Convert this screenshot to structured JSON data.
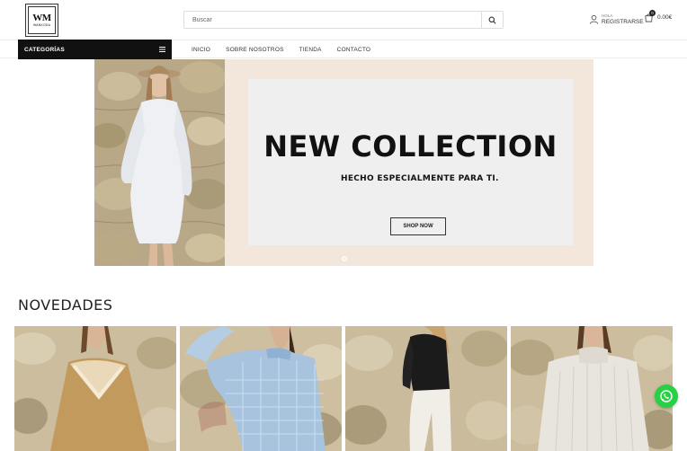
{
  "header": {
    "logo_text": "WM",
    "logo_sub": "WANKODA",
    "search_placeholder": "Buscar",
    "account_greeting": "HOLA",
    "account_label": "REGISTRARSE",
    "cart_count": "0",
    "cart_total": "0.00€"
  },
  "nav": {
    "categories_label": "CATEGORÍAS",
    "items": [
      "INICIO",
      "SOBRE NOSOTROS",
      "TIENDA",
      "CONTACTO"
    ]
  },
  "hero": {
    "title": "NEW COLLECTION",
    "subtitle": "HECHO ESPECIALMENTE PARA TI.",
    "button": "SHOP NOW"
  },
  "novedades": {
    "title": "NOVEDADES",
    "products": [
      {
        "name": "mustard v-neck sweater"
      },
      {
        "name": "blue houndstooth sweater"
      },
      {
        "name": "black top with white pants"
      },
      {
        "name": "cream knit turtleneck"
      }
    ]
  },
  "colors": {
    "accent_dark": "#111111",
    "hero_bg": "#f3e6da",
    "whatsapp": "#27d045"
  }
}
